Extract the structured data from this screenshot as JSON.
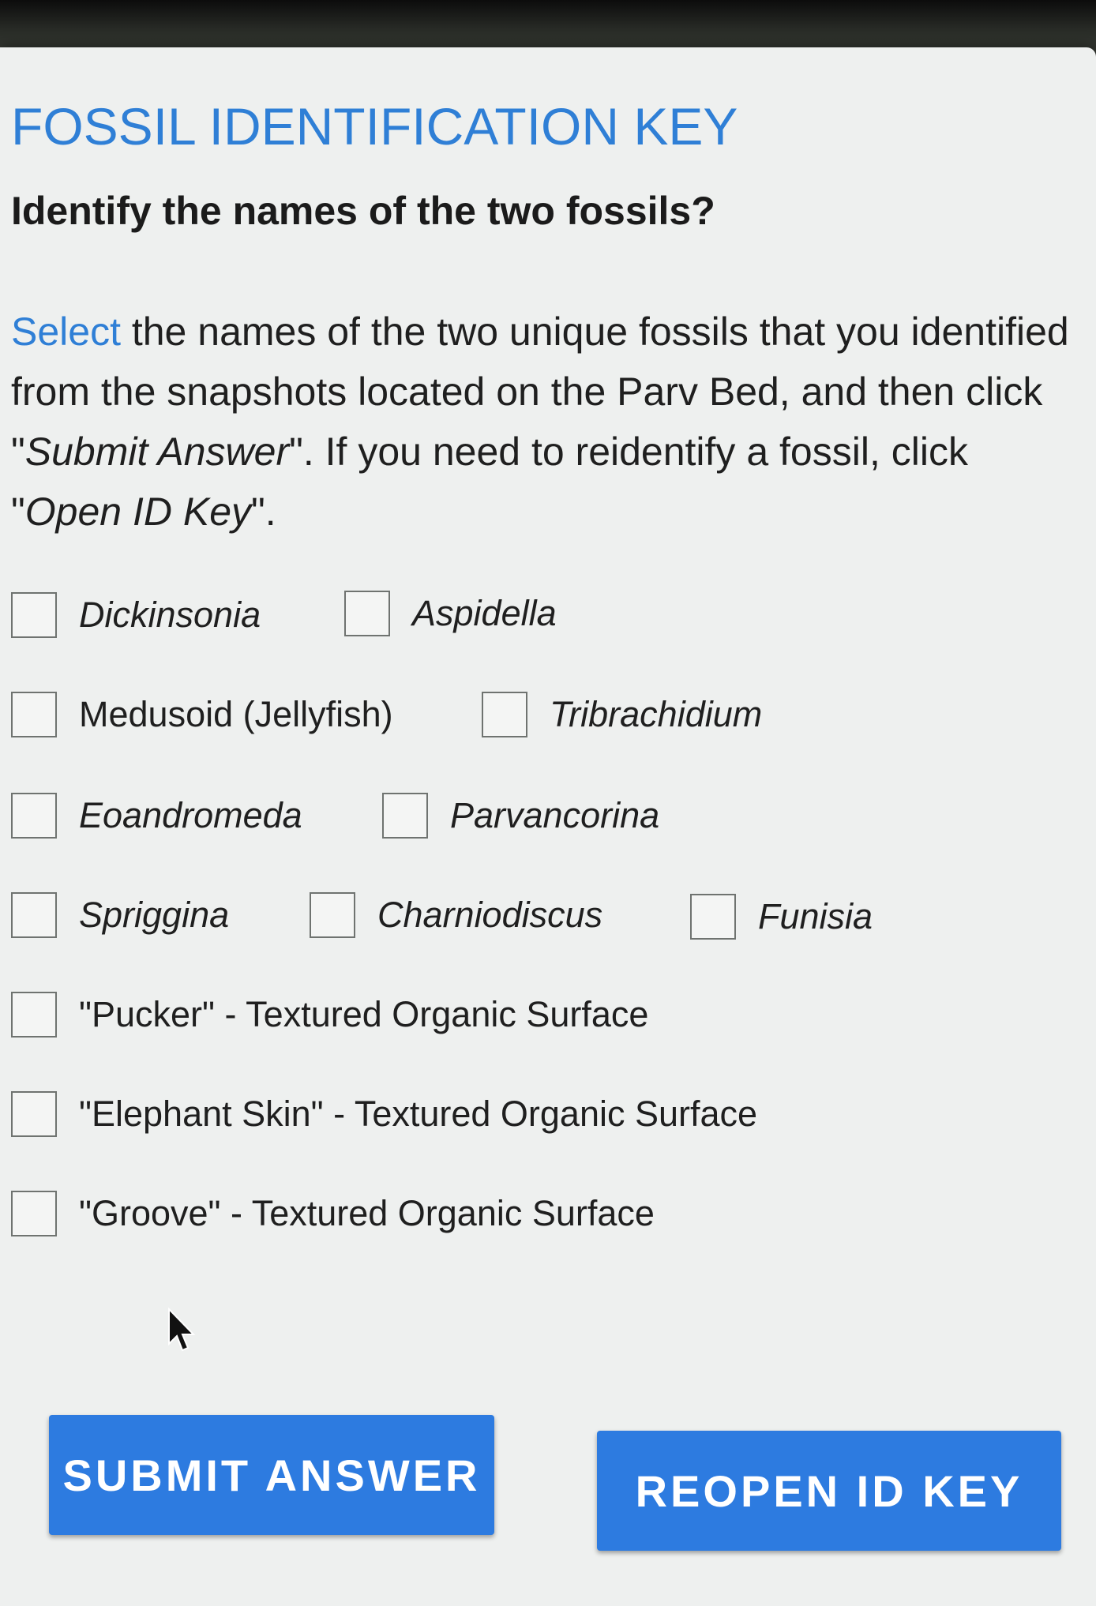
{
  "dialog": {
    "title": "FOSSIL IDENTIFICATION KEY",
    "question": "Identify the names of the two fossils?",
    "instructions": {
      "lead_word": "Select",
      "part1": " the names of the two unique fossils that you identified from the snapshots located on the Parv Bed, and then click \"",
      "submit_ref": "Submit Answer",
      "part2": "\". If you need to reidentify a fossil, click \"",
      "open_ref": "Open ID Key",
      "part3": "\"."
    }
  },
  "options": [
    {
      "label": "Dickinsonia",
      "italic": true,
      "checked": false
    },
    {
      "label": "Aspidella",
      "italic": true,
      "checked": false
    },
    {
      "label": "Medusoid (Jellyfish)",
      "italic": false,
      "checked": false
    },
    {
      "label": "Tribrachidium",
      "italic": true,
      "checked": false
    },
    {
      "label": "Eoandromeda",
      "italic": true,
      "checked": false
    },
    {
      "label": "Parvancorina",
      "italic": true,
      "checked": false
    },
    {
      "label": "Spriggina",
      "italic": true,
      "checked": false
    },
    {
      "label": "Charniodiscus",
      "italic": true,
      "checked": false
    },
    {
      "label": "Funisia",
      "italic": true,
      "checked": false
    },
    {
      "label": "\"Pucker\" - Textured Organic Surface",
      "italic": false,
      "checked": false
    },
    {
      "label": "\"Elephant Skin\" - Textured Organic Surface",
      "italic": false,
      "checked": false
    },
    {
      "label": "\"Groove\" - Textured Organic Surface",
      "italic": false,
      "checked": false
    }
  ],
  "buttons": {
    "submit_label": "SUBMIT ANSWER",
    "reopen_label": "REOPEN ID KEY"
  },
  "colors": {
    "accent": "#2f7fd6",
    "button": "#2d7be0",
    "dialog_bg": "#eef0ef"
  },
  "icons": {
    "pointer": "mouse-cursor-icon"
  }
}
